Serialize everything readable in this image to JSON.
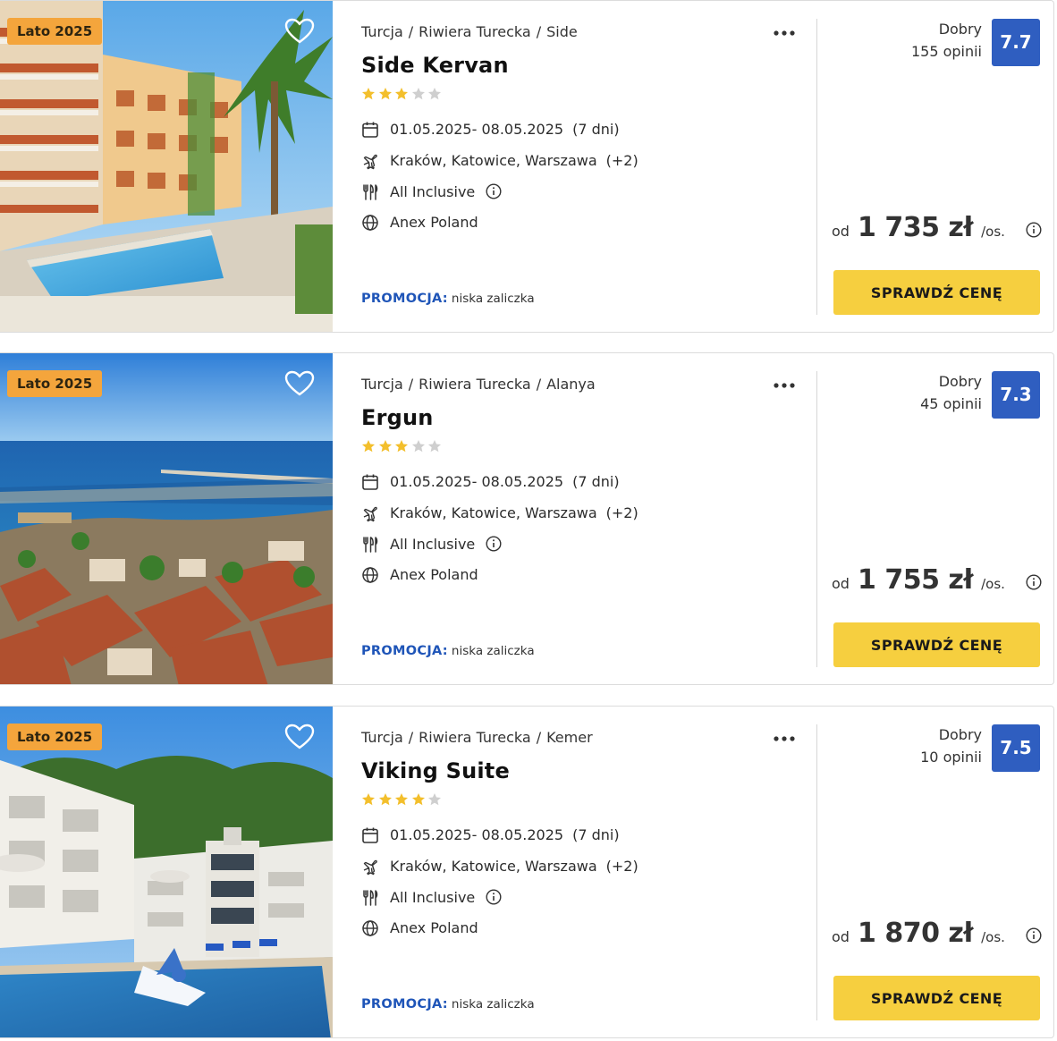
{
  "offers": [
    {
      "season_badge": "Lato 2025",
      "breadcrumb": [
        "Turcja",
        "Riwiera Turecka",
        "Side"
      ],
      "name": "Side Kervan",
      "stars": 3,
      "dates": "01.05.2025- 08.05.2025",
      "duration": "(7 dni)",
      "departures": "Kraków, Katowice, Warszawa",
      "departures_more": "(+2)",
      "board": "All Inclusive",
      "operator": "Anex Poland",
      "promo_label": "PROMOCJA:",
      "promo_text": "niska zaliczka",
      "rating_label": "Dobry",
      "reviews": "155 opinii",
      "rating": "7.7",
      "price_prefix": "od",
      "price": "1 735 zł",
      "price_suffix": "/os.",
      "cta": "SPRAWDŹ CENĘ",
      "photo_icon": "hotel-pool-photo"
    },
    {
      "season_badge": "Lato 2025",
      "breadcrumb": [
        "Turcja",
        "Riwiera Turecka",
        "Alanya"
      ],
      "name": "Ergun",
      "stars": 3,
      "dates": "01.05.2025- 08.05.2025",
      "duration": "(7 dni)",
      "departures": "Kraków, Katowice, Warszawa",
      "departures_more": "(+2)",
      "board": "All Inclusive",
      "operator": "Anex Poland",
      "promo_label": "PROMOCJA:",
      "promo_text": "niska zaliczka",
      "rating_label": "Dobry",
      "reviews": "45 opinii",
      "rating": "7.3",
      "price_prefix": "od",
      "price": "1 755 zł",
      "price_suffix": "/os.",
      "cta": "SPRAWDŹ CENĘ",
      "photo_icon": "harbor-town-photo"
    },
    {
      "season_badge": "Lato 2025",
      "breadcrumb": [
        "Turcja",
        "Riwiera Turecka",
        "Kemer"
      ],
      "name": "Viking Suite",
      "stars": 4,
      "dates": "01.05.2025- 08.05.2025",
      "duration": "(7 dni)",
      "departures": "Kraków, Katowice, Warszawa",
      "departures_more": "(+2)",
      "board": "All Inclusive",
      "operator": "Anex Poland",
      "promo_label": "PROMOCJA:",
      "promo_text": "niska zaliczka",
      "rating_label": "Dobry",
      "reviews": "10 opinii",
      "rating": "7.5",
      "price_prefix": "od",
      "price": "1 870 zł",
      "price_suffix": "/os.",
      "cta": "SPRAWDŹ CENĘ",
      "photo_icon": "resort-pool-photo"
    }
  ],
  "colors": {
    "season_badge": "#f4a53c",
    "rating_badge": "#2f5ec0",
    "cta": "#f6cf3f",
    "promo_label": "#1f55b8",
    "star_on": "#f3bf2c",
    "star_off": "#cfcfcf"
  },
  "icons": [
    "heart-icon",
    "more-icon",
    "calendar-icon",
    "plane-icon",
    "cutlery-icon",
    "globe-icon",
    "info-icon",
    "star-icon"
  ]
}
